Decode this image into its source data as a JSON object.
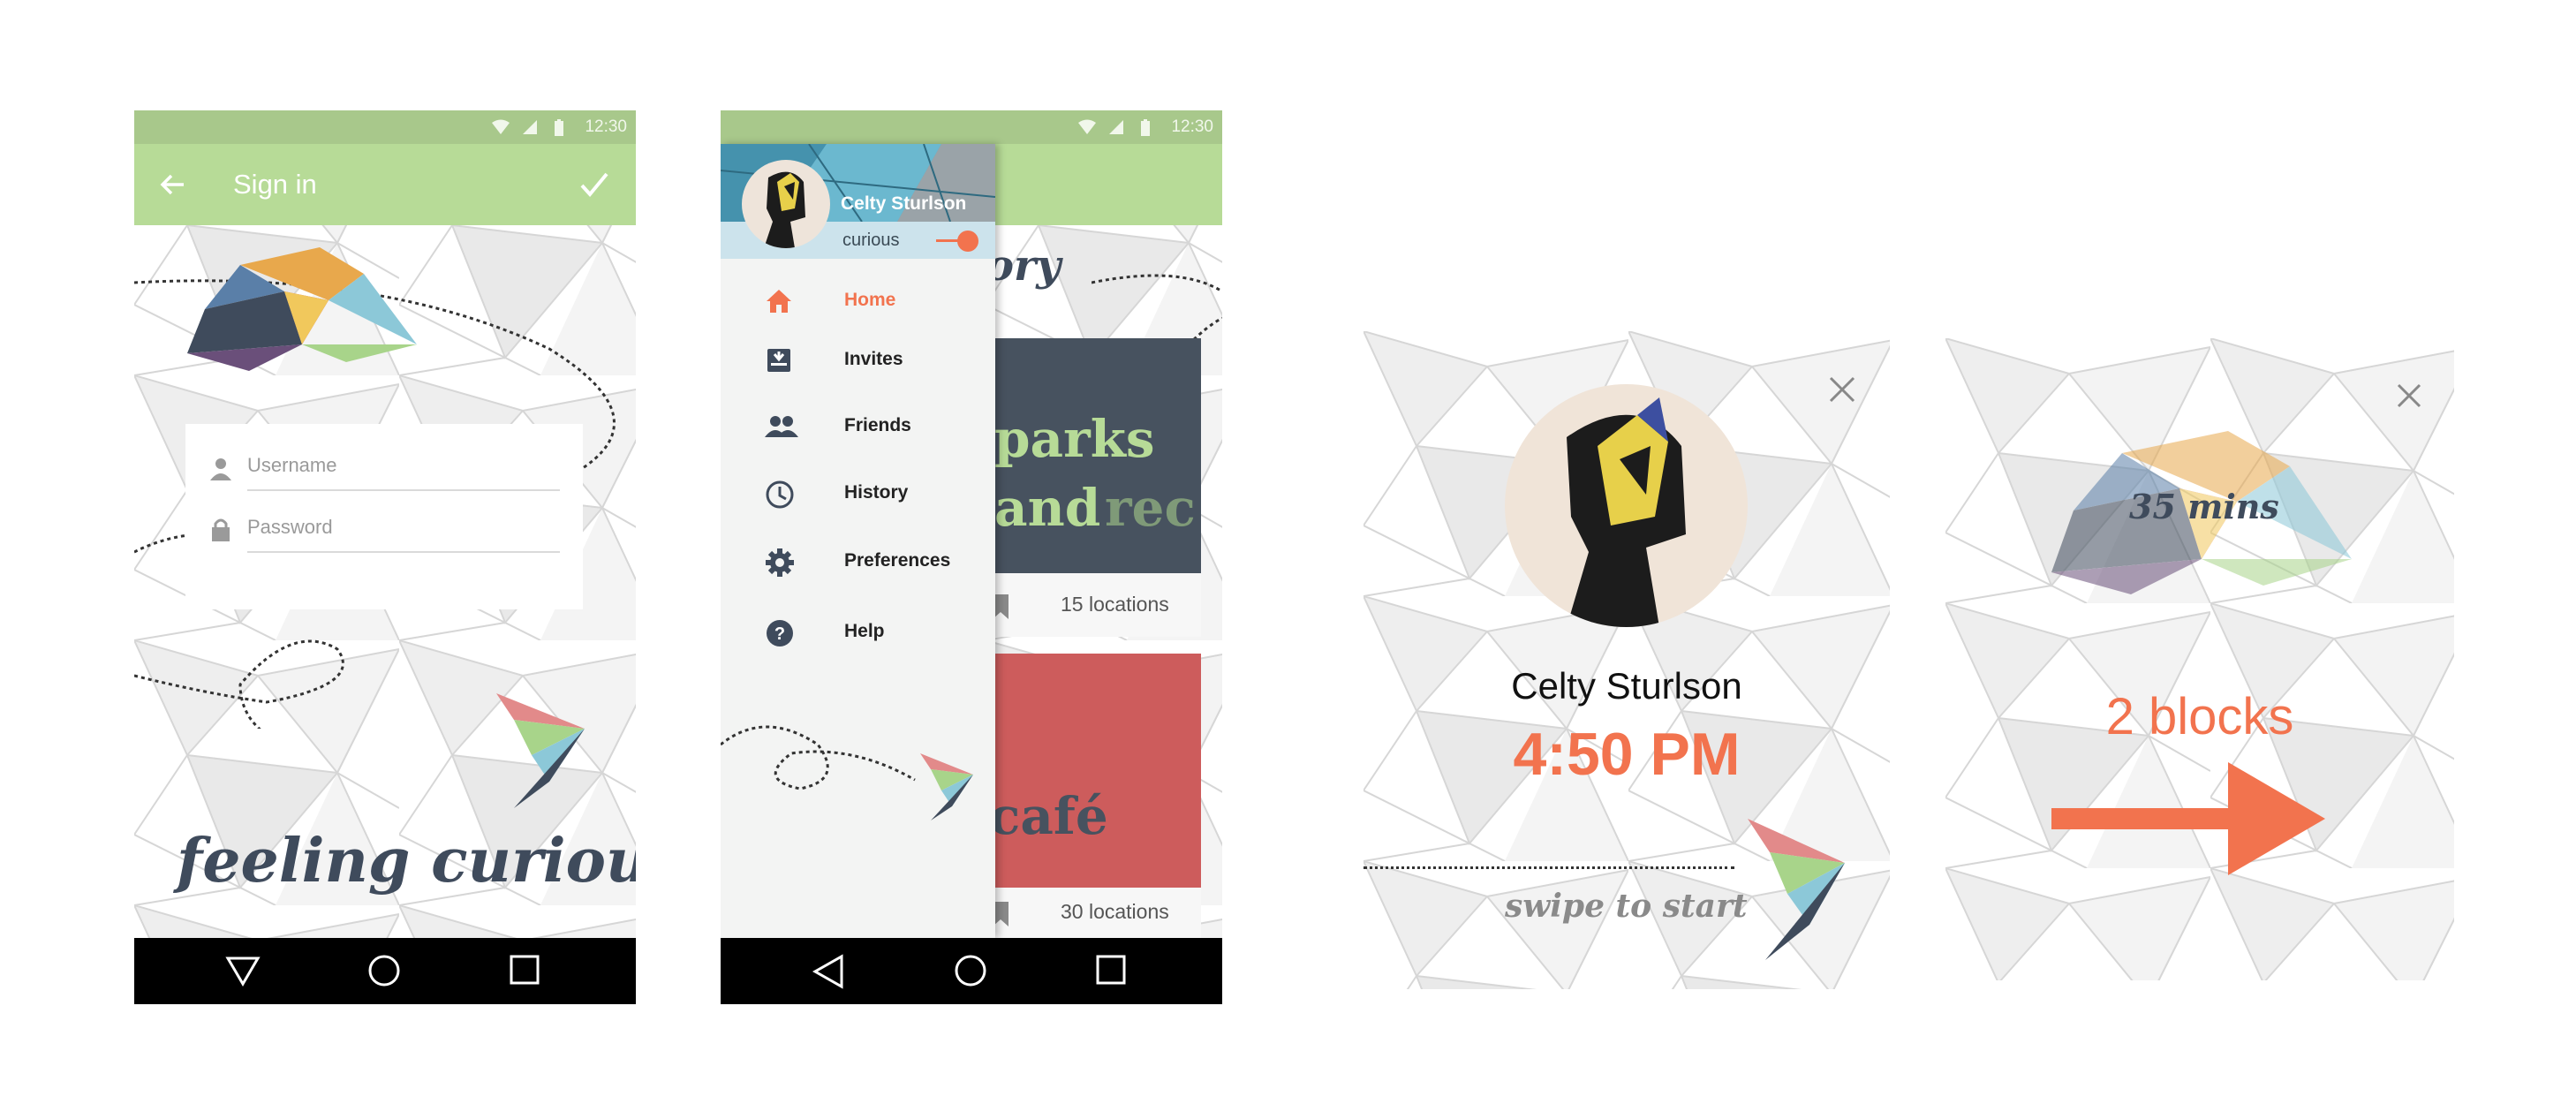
{
  "colors": {
    "status_bar": "#a8c88b",
    "app_bar": "#b7db97",
    "accent": "#f2734e",
    "dark_text": "#3f4b5c",
    "card_parks": "#47525f",
    "card_cafe": "#cd5c5c"
  },
  "signin": {
    "status_time": "12:30",
    "title": "Sign in",
    "username_placeholder": "Username",
    "password_placeholder": "Password",
    "tagline": "feeling curious?"
  },
  "drawer_screen": {
    "status_time": "12:30",
    "profile_name": "Celty Sturlson",
    "profile_status": "curious",
    "background_heading": "ory",
    "menu": [
      {
        "label": "Home",
        "icon": "home-icon",
        "active": true
      },
      {
        "label": "Invites",
        "icon": "invites-icon"
      },
      {
        "label": "Friends",
        "icon": "friends-icon"
      },
      {
        "label": "History",
        "icon": "history-icon"
      },
      {
        "label": "Preferences",
        "icon": "settings-icon"
      },
      {
        "label": "Help",
        "icon": "help-icon"
      }
    ],
    "cards": [
      {
        "title_line1": "parks",
        "title_line2a": "and",
        "title_line2b": "rec",
        "locations": "15 locations"
      },
      {
        "title": "café",
        "locations": "30 locations"
      }
    ]
  },
  "watch_invite": {
    "name": "Celty Sturlson",
    "time": "4:50 PM",
    "hint": "swipe to start"
  },
  "watch_direction": {
    "duration": "35 mins",
    "distance": "2 blocks"
  }
}
